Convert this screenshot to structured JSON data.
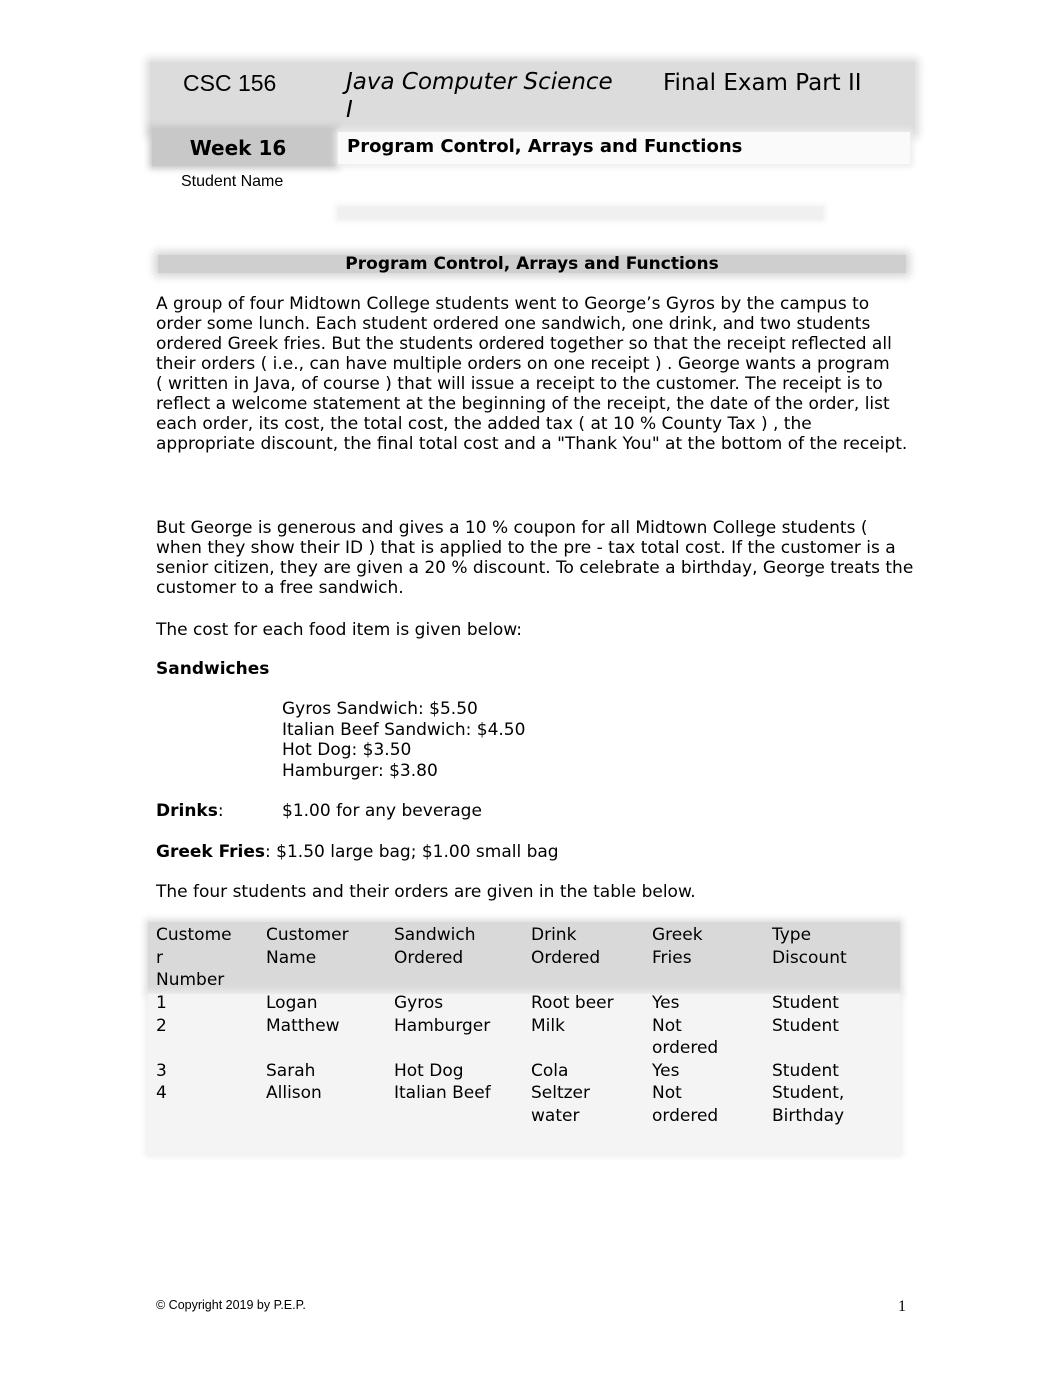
{
  "header": {
    "course": "CSC 156",
    "title": "Java Computer Science",
    "exam": "Final Exam Part II",
    "title_wrap": "I",
    "week": "Week 16",
    "subtitle": "Program Control, Arrays  and Functions",
    "student_name_label": "Student Name",
    "student_name_value": ""
  },
  "section": {
    "title": "Program Control, Arrays and Functions"
  },
  "paragraphs": {
    "p1": "A group of four Midtown College students went to George’s Gyros by the campus to order some lunch.  Each student ordered one sandwich, one drink, and two students ordered Greek fries.  But the students ordered together so that the receipt reflected all their orders ( i.e., can have multiple orders on one receipt ) .  George wants a program",
    "p1b": "( written in Java, of course ) that will issue a receipt to the customer.  The receipt is to reflect a welcome statement at the beginning of the receipt, the date of the order, list each order, its cost, the total cost, the added tax ( at 10 % County Tax ) , the appropriate discount, the final total cost and a \"Thank You\" at the bottom of the receipt.",
    "p2": "But George is generous and gives a 10 % coupon for all Midtown College students ( when they show their ID ) that is applied to the pre - tax total cost.  If the customer is a senior citizen, they are given a 20 % discount.  To celebrate a birthday, George treats the customer to a free sandwich.",
    "p3": "The cost for each food item is given below:",
    "p4": "The four students and their orders are given in the table below."
  },
  "menu": {
    "sandwiches_heading": "Sandwiches",
    "sandwiches": [
      "Gyros Sandwich: $5.50",
      "Italian Beef Sandwich: $4.50",
      "Hot Dog: $3.50",
      "Hamburger: $3.80"
    ],
    "drinks_label": "Drinks",
    "drinks_sep": ":",
    "drinks_value": "$1.00 for any beverage",
    "fries_label": "Greek Fries",
    "fries_sep": ": ",
    "fries_value": "$1.50 large bag; $1.00 small bag"
  },
  "orders_table": {
    "columns": [
      "Custome\nr\nNumber",
      "Customer\nName",
      "Sandwich\nOrdered",
      "Drink\nOrdered",
      "Greek\nFries",
      "Type\nDiscount"
    ],
    "rows": [
      [
        "1",
        "Logan",
        "Gyros",
        "Root beer",
        "Yes",
        "Student"
      ],
      [
        "2",
        "Matthew",
        "Hamburger",
        "Milk",
        "Not\nordered",
        "Student"
      ],
      [
        "3",
        "Sarah",
        "Hot Dog",
        "Cola",
        "Yes",
        "Student"
      ],
      [
        "4",
        "Allison",
        "Italian Beef",
        "Seltzer\nwater",
        "Not\nordered",
        "Student,\nBirthday"
      ]
    ]
  },
  "footer": {
    "copyright": "© Copyright 2019 by P.E.P.",
    "page_number": "1"
  }
}
